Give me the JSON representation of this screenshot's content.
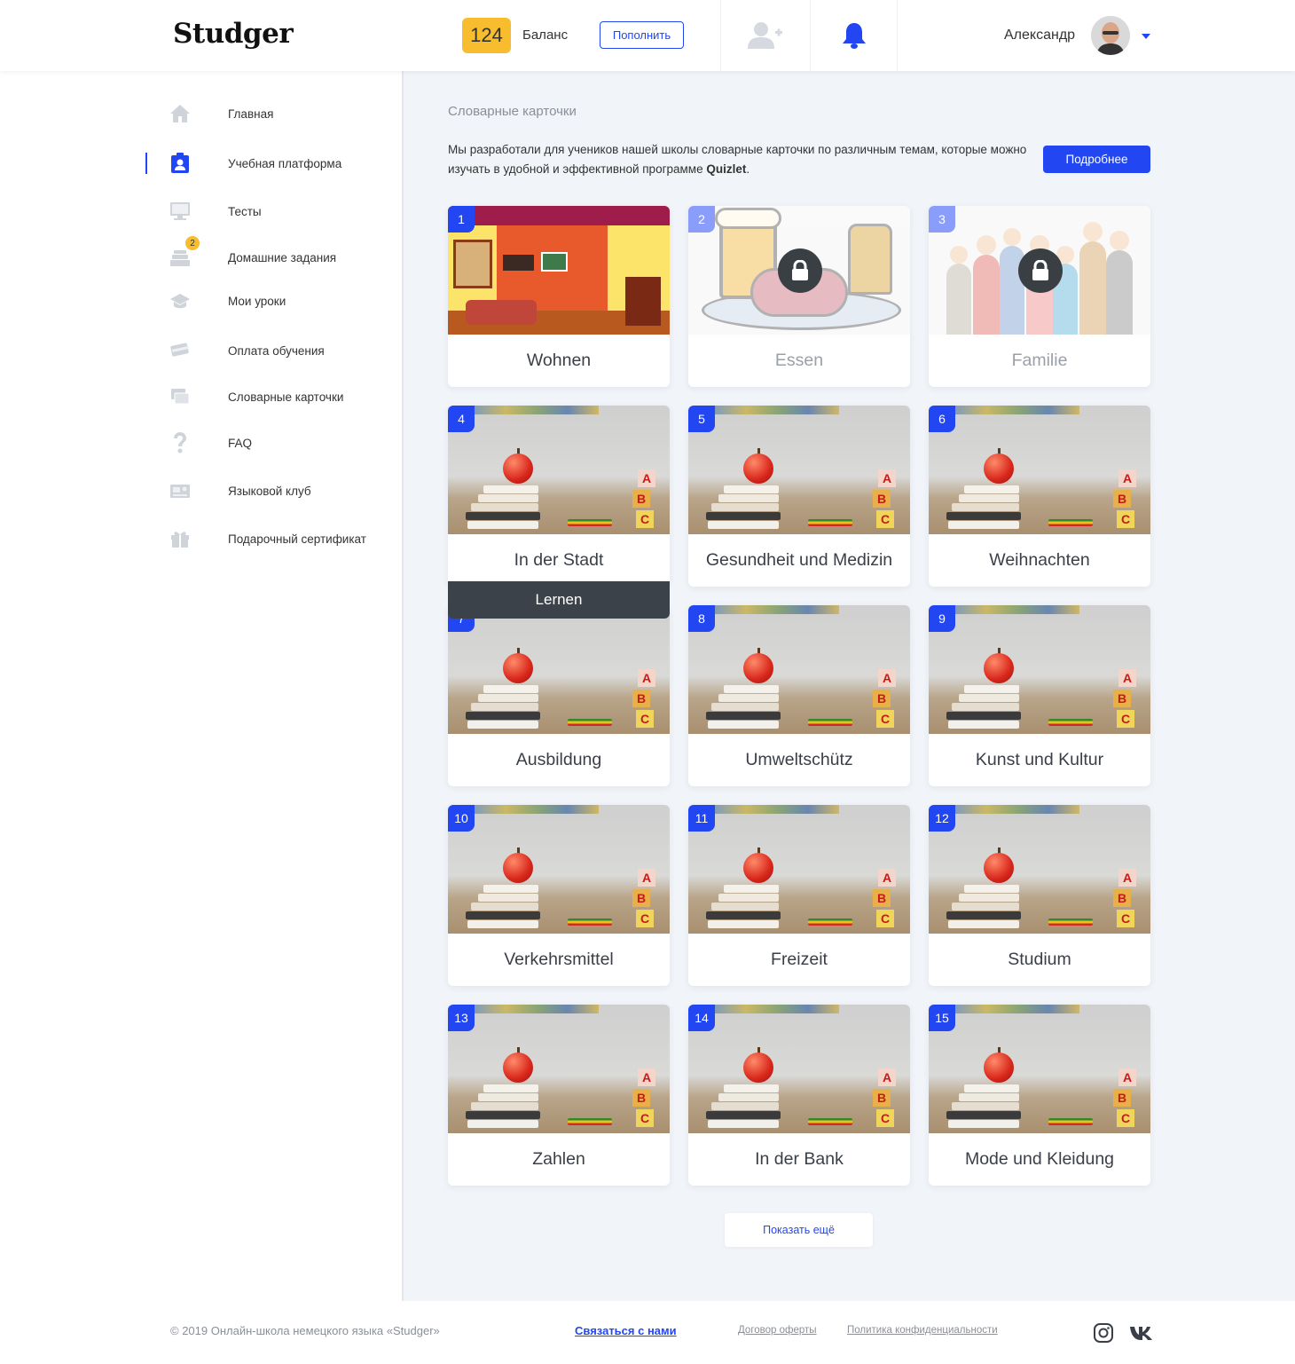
{
  "header": {
    "logo": "Studger",
    "balance_value": "124",
    "balance_label": "Баланс",
    "topup_label": "Пополнить",
    "user_name": "Александр"
  },
  "sidebar": {
    "items": [
      {
        "label": "Главная",
        "icon": "home-icon"
      },
      {
        "label": "Учебная платформа",
        "icon": "id-badge-icon",
        "active": true
      },
      {
        "label": "Тесты",
        "icon": "monitor-icon"
      },
      {
        "label": "Домашние задания",
        "icon": "books-icon",
        "badge": "2"
      },
      {
        "label": "Мои уроки",
        "icon": "graduation-cap-icon"
      },
      {
        "label": "Оплата обучения",
        "icon": "credit-card-icon"
      },
      {
        "label": "Словарные карточки",
        "icon": "cards-icon"
      },
      {
        "label": "FAQ",
        "icon": "question-icon"
      },
      {
        "label": "Языковой клуб",
        "icon": "club-icon"
      },
      {
        "label": "Подарочный сертификат",
        "icon": "gift-icon"
      }
    ]
  },
  "main": {
    "section_title": "Словарные карточки",
    "intro_text": "Мы разработали для учеников нашей школы словарные карточки по различным темам, которые можно изучать в удобной и эффективной программе ",
    "intro_brand": "Quizlet",
    "intro_end": ".",
    "more_label": "Подробнее",
    "cards": [
      {
        "num": "1",
        "title": "Wohnen",
        "locked": false
      },
      {
        "num": "2",
        "title": "Essen",
        "locked": true
      },
      {
        "num": "3",
        "title": "Familie",
        "locked": true
      },
      {
        "num": "4",
        "title": "In der Stadt",
        "locked": false
      },
      {
        "num": "5",
        "title": "Gesundheit und Medizin",
        "locked": false
      },
      {
        "num": "6",
        "title": "Weihnachten",
        "locked": false
      },
      {
        "num": "7",
        "title": "Ausbildung",
        "locked": false
      },
      {
        "num": "8",
        "title": "Umweltschütz",
        "locked": false
      },
      {
        "num": "9",
        "title": "Kunst und Kultur",
        "locked": false
      },
      {
        "num": "10",
        "title": "Verkehrsmittel",
        "locked": false
      },
      {
        "num": "11",
        "title": "Freizeit",
        "locked": false
      },
      {
        "num": "12",
        "title": "Studium",
        "locked": false
      },
      {
        "num": "13",
        "title": "Zahlen",
        "locked": false
      },
      {
        "num": "14",
        "title": "In der Bank",
        "locked": false
      },
      {
        "num": "15",
        "title": "Mode und Kleidung",
        "locked": false
      }
    ],
    "lernen_label": "Lernen",
    "show_more_label": "Показать ещё"
  },
  "footer": {
    "copyright": "© 2019 Онлайн-школа немецкого языка «Studger»",
    "contact": "Связаться с нами",
    "offer": "Договор оферты",
    "privacy": "Политика конфиденциальности"
  },
  "colors": {
    "accent": "#2247f2",
    "balance": "#f8bd2e",
    "dark": "#3b4249"
  }
}
